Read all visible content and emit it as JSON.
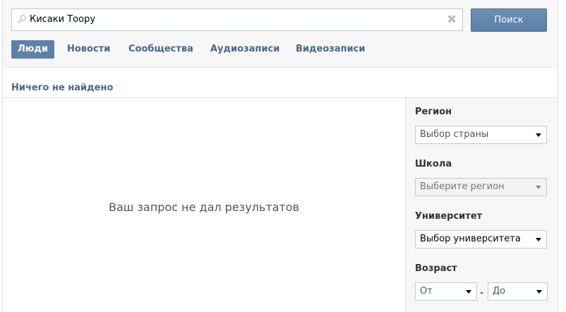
{
  "search": {
    "query": "Кисаки Тоору",
    "button_label": "Поиск"
  },
  "tabs": [
    {
      "label": "Люди",
      "active": true
    },
    {
      "label": "Новости",
      "active": false
    },
    {
      "label": "Сообщества",
      "active": false
    },
    {
      "label": "Аудиозаписи",
      "active": false
    },
    {
      "label": "Видеозаписи",
      "active": false
    }
  ],
  "results": {
    "header": "Ничего не найдено",
    "empty_message": "Ваш запрос не дал результатов"
  },
  "filters": {
    "region": {
      "label": "Регион",
      "value": "Выбор страны"
    },
    "school": {
      "label": "Школа",
      "value": "Выберите регион"
    },
    "university": {
      "label": "Университет",
      "value": "Выбор университета"
    },
    "age": {
      "label": "Возраст",
      "from": "От",
      "separator": "-",
      "to": "До"
    }
  },
  "colors": {
    "accent": "#5e81a8",
    "link": "#45688e"
  }
}
